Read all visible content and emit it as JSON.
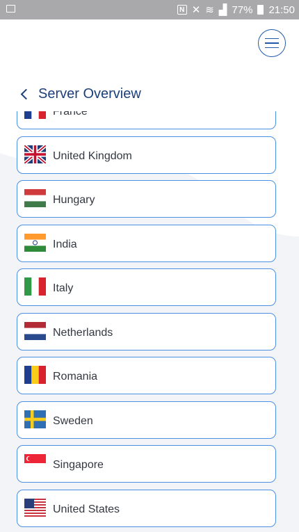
{
  "status_bar": {
    "battery_percent": "77%",
    "time": "21:50"
  },
  "header": {
    "title": "Server Overview",
    "menu_icon": "hamburger-icon",
    "back_icon": "chevron-left-icon"
  },
  "colors": {
    "accent": "#1e5aa8",
    "title": "#1c3f7a",
    "item_border": "#4a90e2",
    "status_bar": "#a9a9ab"
  },
  "servers": [
    {
      "country": "France",
      "flag": "fr"
    },
    {
      "country": "United Kingdom",
      "flag": "gb"
    },
    {
      "country": "Hungary",
      "flag": "hu"
    },
    {
      "country": "India",
      "flag": "in"
    },
    {
      "country": "Italy",
      "flag": "it"
    },
    {
      "country": "Netherlands",
      "flag": "nl"
    },
    {
      "country": "Romania",
      "flag": "ro"
    },
    {
      "country": "Sweden",
      "flag": "se"
    },
    {
      "country": "Singapore",
      "flag": "sg"
    },
    {
      "country": "United States",
      "flag": "us"
    }
  ]
}
